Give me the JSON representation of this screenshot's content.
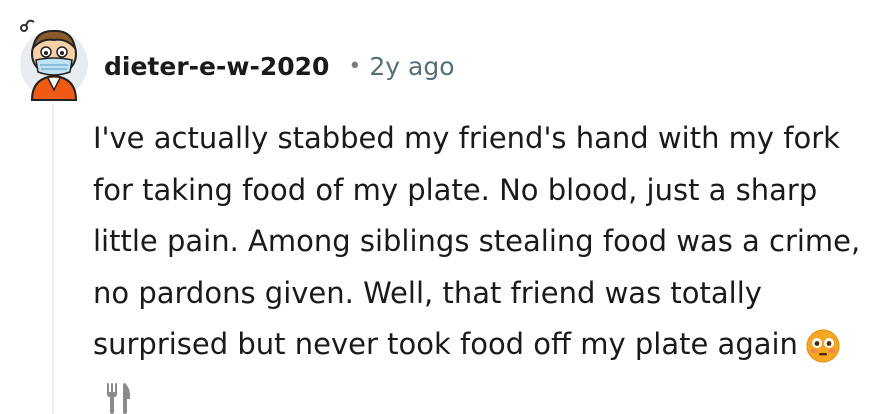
{
  "comment": {
    "author": "dieter-e-w-2020",
    "separator": "•",
    "timestamp": "2y ago",
    "body": "I've actually stabbed my friend's hand with my fork for taking food of my plate. No blood, just a sharp little pain. Among siblings stealing food was a crime, no pardons given. Well, that friend was totally surprised but never took food off my plate again",
    "trailing_icons": [
      "flushed-face-emoji",
      "fork-and-knife-icon"
    ]
  },
  "colors": {
    "text": "#1a1a1b",
    "meta": "#576f76",
    "thread_line": "#edeff1",
    "emoji_face": "#f5a623",
    "utensils": "#8a8a8a"
  }
}
